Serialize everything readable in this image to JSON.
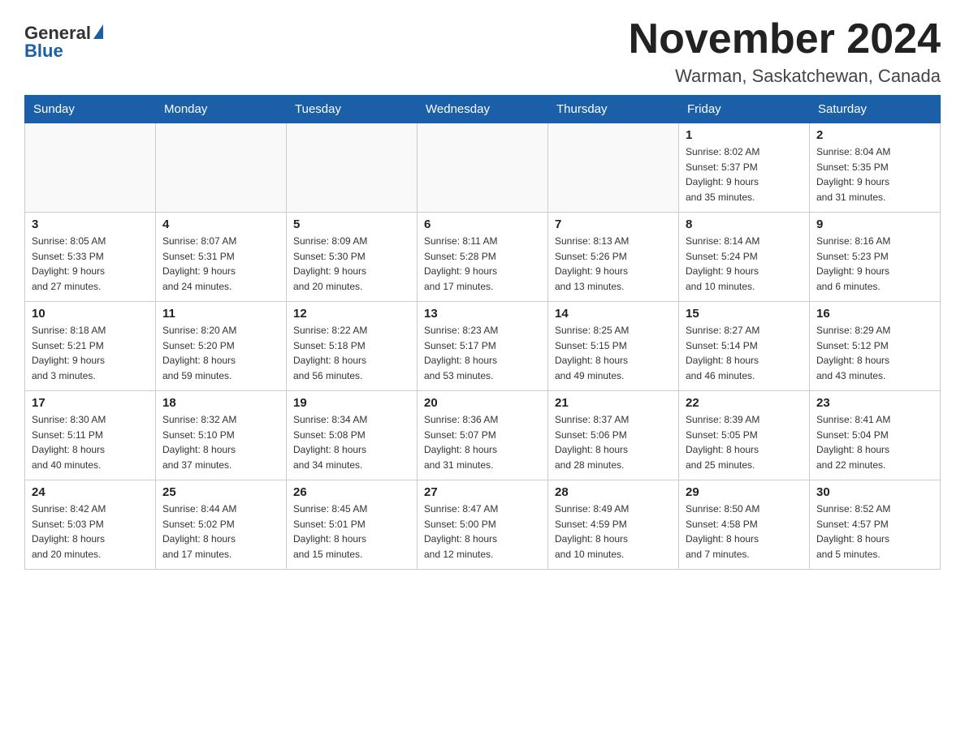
{
  "header": {
    "logo_general": "General",
    "logo_blue": "Blue",
    "month": "November 2024",
    "location": "Warman, Saskatchewan, Canada"
  },
  "weekdays": [
    "Sunday",
    "Monday",
    "Tuesday",
    "Wednesday",
    "Thursday",
    "Friday",
    "Saturday"
  ],
  "weeks": [
    [
      {
        "day": "",
        "info": ""
      },
      {
        "day": "",
        "info": ""
      },
      {
        "day": "",
        "info": ""
      },
      {
        "day": "",
        "info": ""
      },
      {
        "day": "",
        "info": ""
      },
      {
        "day": "1",
        "info": "Sunrise: 8:02 AM\nSunset: 5:37 PM\nDaylight: 9 hours\nand 35 minutes."
      },
      {
        "day": "2",
        "info": "Sunrise: 8:04 AM\nSunset: 5:35 PM\nDaylight: 9 hours\nand 31 minutes."
      }
    ],
    [
      {
        "day": "3",
        "info": "Sunrise: 8:05 AM\nSunset: 5:33 PM\nDaylight: 9 hours\nand 27 minutes."
      },
      {
        "day": "4",
        "info": "Sunrise: 8:07 AM\nSunset: 5:31 PM\nDaylight: 9 hours\nand 24 minutes."
      },
      {
        "day": "5",
        "info": "Sunrise: 8:09 AM\nSunset: 5:30 PM\nDaylight: 9 hours\nand 20 minutes."
      },
      {
        "day": "6",
        "info": "Sunrise: 8:11 AM\nSunset: 5:28 PM\nDaylight: 9 hours\nand 17 minutes."
      },
      {
        "day": "7",
        "info": "Sunrise: 8:13 AM\nSunset: 5:26 PM\nDaylight: 9 hours\nand 13 minutes."
      },
      {
        "day": "8",
        "info": "Sunrise: 8:14 AM\nSunset: 5:24 PM\nDaylight: 9 hours\nand 10 minutes."
      },
      {
        "day": "9",
        "info": "Sunrise: 8:16 AM\nSunset: 5:23 PM\nDaylight: 9 hours\nand 6 minutes."
      }
    ],
    [
      {
        "day": "10",
        "info": "Sunrise: 8:18 AM\nSunset: 5:21 PM\nDaylight: 9 hours\nand 3 minutes."
      },
      {
        "day": "11",
        "info": "Sunrise: 8:20 AM\nSunset: 5:20 PM\nDaylight: 8 hours\nand 59 minutes."
      },
      {
        "day": "12",
        "info": "Sunrise: 8:22 AM\nSunset: 5:18 PM\nDaylight: 8 hours\nand 56 minutes."
      },
      {
        "day": "13",
        "info": "Sunrise: 8:23 AM\nSunset: 5:17 PM\nDaylight: 8 hours\nand 53 minutes."
      },
      {
        "day": "14",
        "info": "Sunrise: 8:25 AM\nSunset: 5:15 PM\nDaylight: 8 hours\nand 49 minutes."
      },
      {
        "day": "15",
        "info": "Sunrise: 8:27 AM\nSunset: 5:14 PM\nDaylight: 8 hours\nand 46 minutes."
      },
      {
        "day": "16",
        "info": "Sunrise: 8:29 AM\nSunset: 5:12 PM\nDaylight: 8 hours\nand 43 minutes."
      }
    ],
    [
      {
        "day": "17",
        "info": "Sunrise: 8:30 AM\nSunset: 5:11 PM\nDaylight: 8 hours\nand 40 minutes."
      },
      {
        "day": "18",
        "info": "Sunrise: 8:32 AM\nSunset: 5:10 PM\nDaylight: 8 hours\nand 37 minutes."
      },
      {
        "day": "19",
        "info": "Sunrise: 8:34 AM\nSunset: 5:08 PM\nDaylight: 8 hours\nand 34 minutes."
      },
      {
        "day": "20",
        "info": "Sunrise: 8:36 AM\nSunset: 5:07 PM\nDaylight: 8 hours\nand 31 minutes."
      },
      {
        "day": "21",
        "info": "Sunrise: 8:37 AM\nSunset: 5:06 PM\nDaylight: 8 hours\nand 28 minutes."
      },
      {
        "day": "22",
        "info": "Sunrise: 8:39 AM\nSunset: 5:05 PM\nDaylight: 8 hours\nand 25 minutes."
      },
      {
        "day": "23",
        "info": "Sunrise: 8:41 AM\nSunset: 5:04 PM\nDaylight: 8 hours\nand 22 minutes."
      }
    ],
    [
      {
        "day": "24",
        "info": "Sunrise: 8:42 AM\nSunset: 5:03 PM\nDaylight: 8 hours\nand 20 minutes."
      },
      {
        "day": "25",
        "info": "Sunrise: 8:44 AM\nSunset: 5:02 PM\nDaylight: 8 hours\nand 17 minutes."
      },
      {
        "day": "26",
        "info": "Sunrise: 8:45 AM\nSunset: 5:01 PM\nDaylight: 8 hours\nand 15 minutes."
      },
      {
        "day": "27",
        "info": "Sunrise: 8:47 AM\nSunset: 5:00 PM\nDaylight: 8 hours\nand 12 minutes."
      },
      {
        "day": "28",
        "info": "Sunrise: 8:49 AM\nSunset: 4:59 PM\nDaylight: 8 hours\nand 10 minutes."
      },
      {
        "day": "29",
        "info": "Sunrise: 8:50 AM\nSunset: 4:58 PM\nDaylight: 8 hours\nand 7 minutes."
      },
      {
        "day": "30",
        "info": "Sunrise: 8:52 AM\nSunset: 4:57 PM\nDaylight: 8 hours\nand 5 minutes."
      }
    ]
  ]
}
